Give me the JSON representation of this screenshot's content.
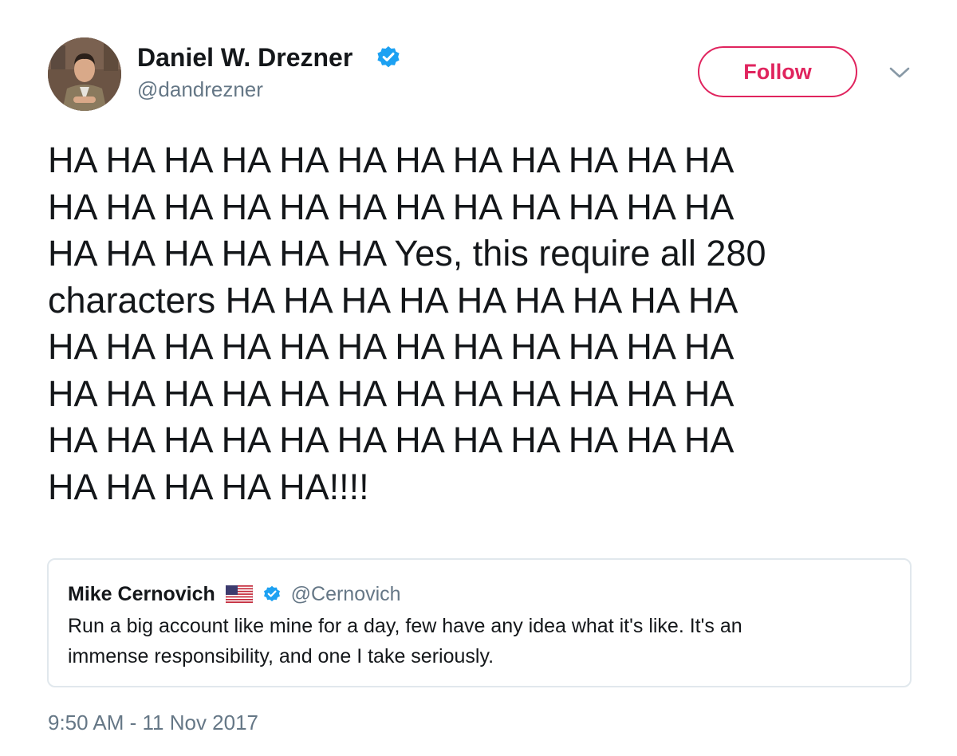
{
  "author": {
    "name": "Daniel W. Drezner",
    "handle": "@dandrezner",
    "verified": true
  },
  "actions": {
    "follow_label": "Follow",
    "follow_color": "#e0245e"
  },
  "tweet": {
    "lines": [
      "HA HA HA HA HA HA HA HA HA HA HA HA",
      "HA HA HA HA HA HA HA HA HA HA HA HA",
      "HA HA HA HA HA HA Yes, this require all 280",
      "characters HA HA HA HA HA HA HA HA HA",
      "HA HA HA HA HA HA HA HA HA HA HA HA",
      "HA HA HA HA HA HA HA HA HA HA HA HA",
      "HA HA HA HA HA HA HA HA HA HA HA HA",
      "HA HA HA HA HA!!!!"
    ]
  },
  "quoted_tweet": {
    "name": "Mike Cernovich",
    "handle": "@Cernovich",
    "verified": true,
    "flag_icon": "us-flag-icon",
    "lines": [
      "Run a big account like mine for a day, few have any idea what it's like. It's an",
      "immense responsibility, and one I take seriously."
    ]
  },
  "timestamp": "9:50 AM - 11 Nov 2017",
  "colors": {
    "verified_blue": "#1da1f2",
    "secondary_text": "#657786",
    "border": "#e1e8ed"
  }
}
